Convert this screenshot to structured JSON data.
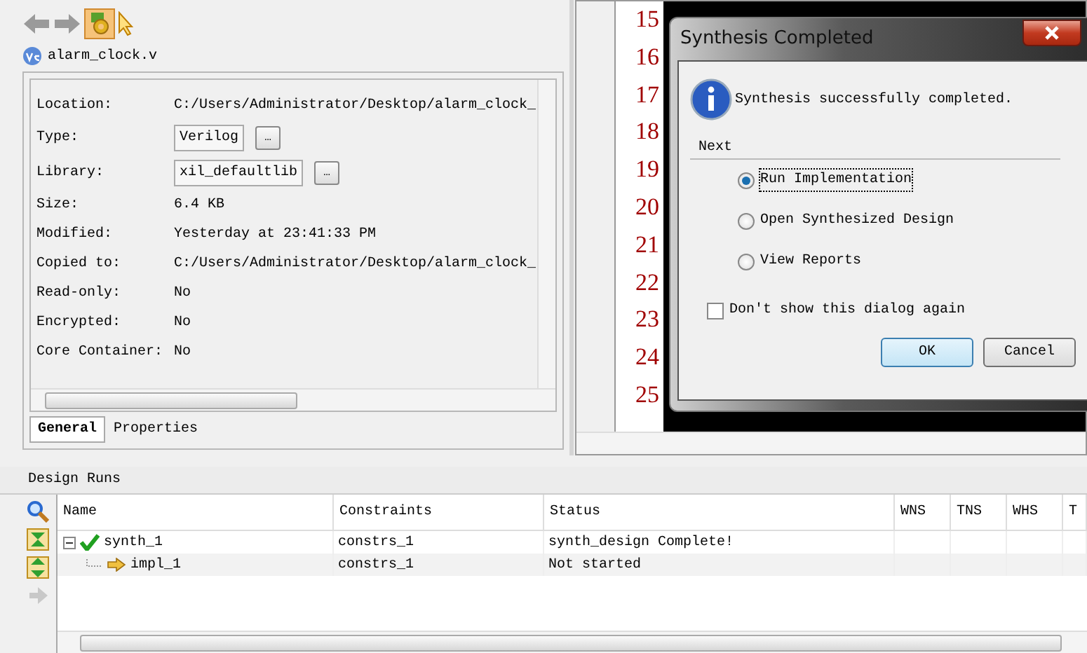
{
  "file": {
    "name": "alarm_clock.v"
  },
  "properties": [
    {
      "label": "Location:",
      "value": "C:/Users/Administrator/Desktop/alarm_clock_",
      "kind": "text"
    },
    {
      "label": "Type:",
      "value": "Verilog",
      "kind": "field",
      "button": "…"
    },
    {
      "label": "Library:",
      "value": "xil_defaultlib",
      "kind": "field",
      "button": "…"
    },
    {
      "label": "Size:",
      "value": "6.4 KB",
      "kind": "text"
    },
    {
      "label": "Modified:",
      "value": "Yesterday at 23:41:33 PM",
      "kind": "text"
    },
    {
      "label": "Copied to:",
      "value": "C:/Users/Administrator/Desktop/alarm_clock_",
      "kind": "text"
    },
    {
      "label": "Read-only:",
      "value": "No",
      "kind": "text"
    },
    {
      "label": "Encrypted:",
      "value": "No",
      "kind": "text"
    },
    {
      "label": "Core Container:",
      "value": "No",
      "kind": "text"
    }
  ],
  "tabs": [
    {
      "label": "General",
      "selected": true
    },
    {
      "label": "Properties",
      "selected": false
    }
  ],
  "editor": {
    "line_numbers": [
      "15",
      "16",
      "17",
      "18",
      "19",
      "20",
      "21",
      "22",
      "23",
      "24",
      "25"
    ]
  },
  "dialog": {
    "title": "Synthesis Completed",
    "message": "Synthesis successfully completed.",
    "group_label": "Next",
    "options": [
      {
        "label": "Run Implementation",
        "selected": true
      },
      {
        "label": "Open Synthesized Design",
        "selected": false
      },
      {
        "label": "View Reports",
        "selected": false
      }
    ],
    "dont_show": {
      "label": "Don't show this dialog again",
      "checked": false
    },
    "buttons": [
      {
        "label": "OK",
        "default": true
      },
      {
        "label": "Cancel",
        "default": false
      }
    ]
  },
  "design_runs": {
    "title": "Design Runs",
    "columns": [
      "Name",
      "Constraints",
      "Status",
      "WNS",
      "TNS",
      "WHS",
      "T"
    ],
    "rows": [
      {
        "name": "synth_1",
        "kind": "done",
        "constraints": "constrs_1",
        "status": "synth_design Complete!",
        "expanded": true,
        "children": [
          {
            "name": "impl_1",
            "kind": "pending",
            "constraints": "constrs_1",
            "status": "Not started"
          }
        ]
      }
    ]
  }
}
